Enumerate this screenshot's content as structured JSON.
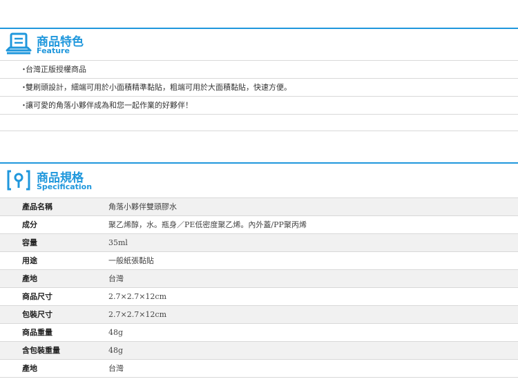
{
  "feature": {
    "title": "商品特色",
    "subtitle": "Feature",
    "icon": "monitor-icon",
    "bullet": "・",
    "items": [
      "台灣正版授權商品",
      "雙刷頭設計，細端可用於小面積精準黏貼，粗端可用於大面積黏貼，快速方便。",
      "讓可愛的角落小夥伴成為和您一起作業的好夥伴！"
    ]
  },
  "specification": {
    "title": "商品規格",
    "subtitle": "Specification",
    "icon": "bracket-pin-icon",
    "rows": [
      {
        "label": "產品名稱",
        "value": "角落小夥伴雙頭膠水"
      },
      {
        "label": "成分",
        "value": "聚乙烯醇，水。瓶身／PE低密度聚乙烯。內外蓋/PP聚丙烯"
      },
      {
        "label": "容量",
        "value": "35ml"
      },
      {
        "label": "用途",
        "value": "一般紙張黏貼"
      },
      {
        "label": "產地",
        "value": "台灣"
      },
      {
        "label": "商品尺寸",
        "value": "2.7×2.7×12cm"
      },
      {
        "label": "包裝尺寸",
        "value": "2.7×2.7×12cm"
      },
      {
        "label": "商品重量",
        "value": "48g"
      },
      {
        "label": "含包裝重量",
        "value": "48g"
      },
      {
        "label": "產地",
        "value": "台灣"
      }
    ]
  },
  "colors": {
    "accent": "#1f97dc",
    "row_alt": "#f1f1f1",
    "divider": "#d8d8d8"
  }
}
